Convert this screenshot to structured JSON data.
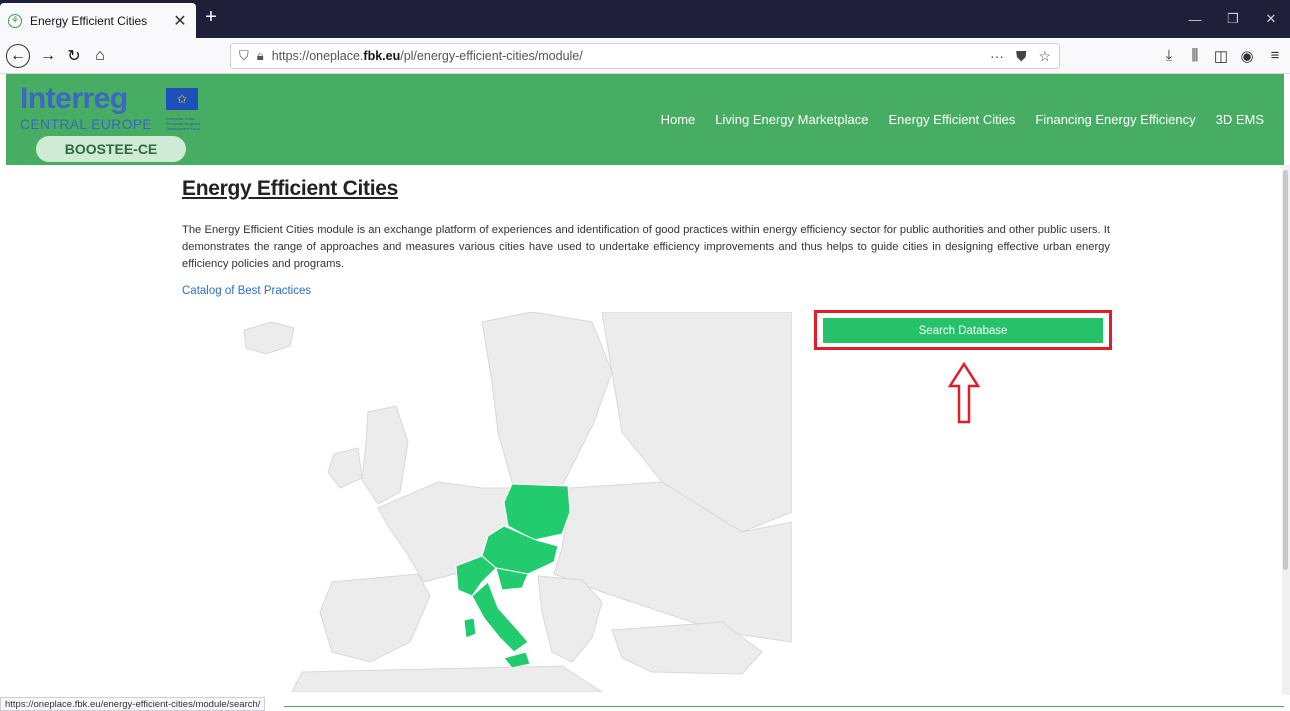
{
  "browser": {
    "tab_title": "Energy Efficient Cities",
    "tab_close": "✕",
    "new_tab": "+",
    "url_prefix": "https://oneplace.",
    "url_host": "fbk.eu",
    "url_path": "/pl/energy-efficient-cities/module/",
    "url_more": "···",
    "status_url": "https://oneplace.fbk.eu/energy-efficient-cities/module/search/"
  },
  "header": {
    "logo_word": "Interreg",
    "logo_sub": "CENTRAL EUROPE",
    "logo_tiny": "European Union European Regional Development Fund",
    "logo_pill": "BOOSTEE-CE",
    "menu": [
      "Home",
      "Living Energy Marketplace",
      "Energy Efficient Cities",
      "Financing Energy Efficiency",
      "3D EMS"
    ]
  },
  "content": {
    "title": "Energy Efficient Cities",
    "intro": "The Energy Efficient Cities module is an exchange platform of experiences and identification of good practices within energy efficiency sector for public authorities and other public users. It demonstrates the range of approaches and measures various cities have used to undertake efficiency improvements and thus helps to guide cities in designing effective urban energy efficiency policies and programs.",
    "catalog_link": "Catalog of Best Practices",
    "search_button": "Search Database"
  },
  "colors": {
    "header_green": "#46ad63",
    "button_green": "#26c26a",
    "highlight_red": "#e11d2a",
    "map_land": "#ececec",
    "map_highlight": "#22cc6e"
  }
}
